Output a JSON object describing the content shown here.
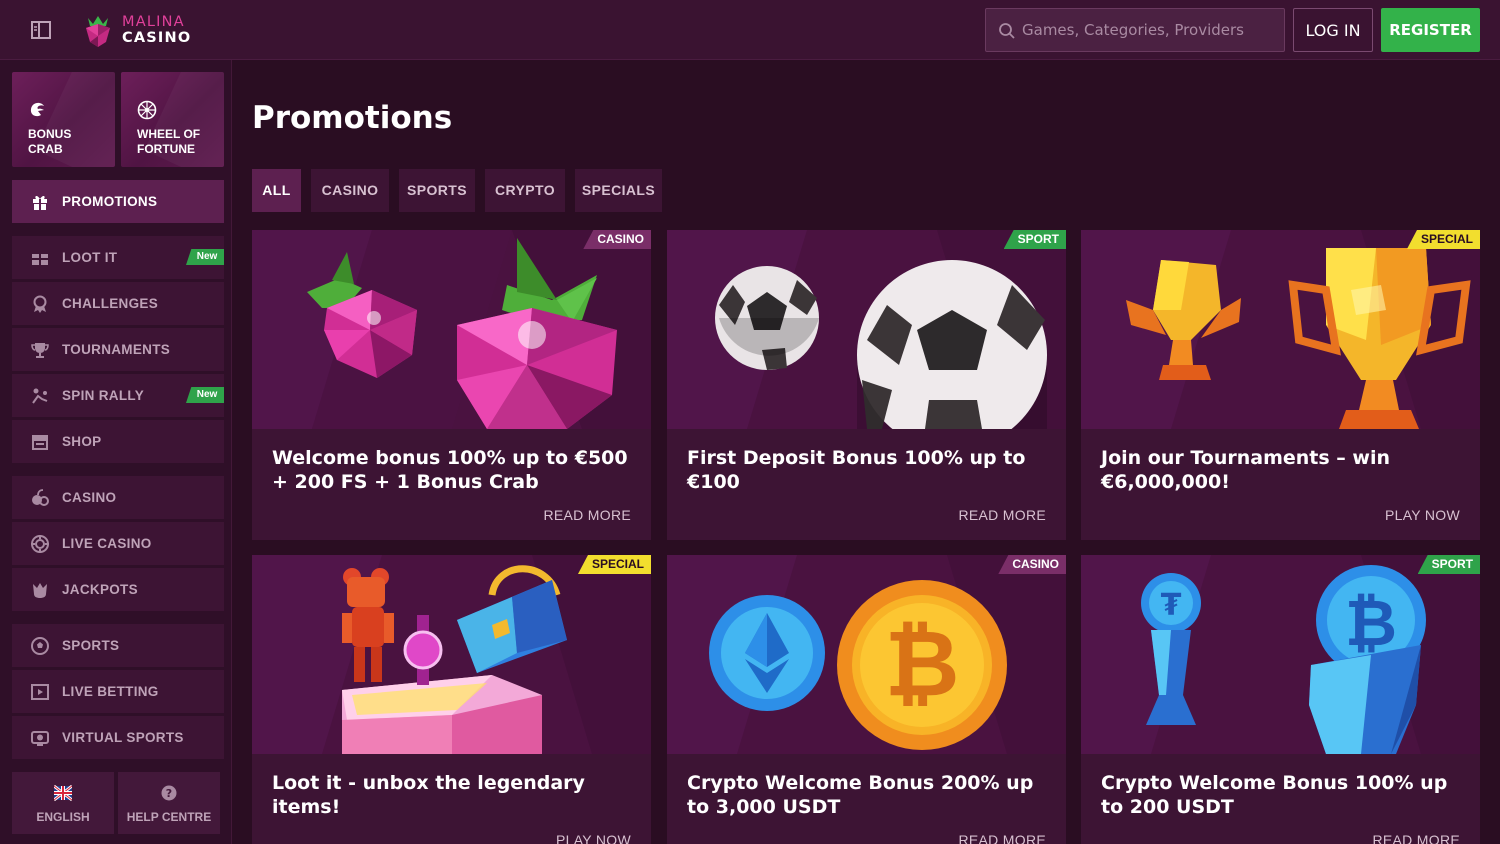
{
  "header": {
    "logo_line1": "MALINA",
    "logo_line2": "CASINO",
    "search_placeholder": "Games, Categories, Providers",
    "login_label": "LOG IN",
    "register_label": "REGISTER"
  },
  "sidebar": {
    "tiles": [
      {
        "label": "BONUS CRAB",
        "icon": "crab-claw-icon"
      },
      {
        "label": "WHEEL OF FORTUNE",
        "icon": "wheel-icon"
      }
    ],
    "promotions_label": "PROMOTIONS",
    "items": [
      {
        "label": "LOOT IT",
        "badge": "New",
        "icon": "gift-icon"
      },
      {
        "label": "CHALLENGES",
        "badge": "",
        "icon": "medal-icon"
      },
      {
        "label": "TOURNAMENTS",
        "badge": "",
        "icon": "trophy-icon"
      },
      {
        "label": "SPIN RALLY",
        "badge": "New",
        "icon": "rally-icon"
      },
      {
        "label": "SHOP",
        "badge": "",
        "icon": "shop-icon"
      },
      {
        "label": "CASINO",
        "badge": "",
        "icon": "casino-icon"
      },
      {
        "label": "LIVE CASINO",
        "badge": "",
        "icon": "chip-icon"
      },
      {
        "label": "JACKPOTS",
        "badge": "",
        "icon": "jackpot-icon"
      },
      {
        "label": "SPORTS",
        "badge": "",
        "icon": "football-icon"
      },
      {
        "label": "LIVE BETTING",
        "badge": "",
        "icon": "live-betting-icon"
      },
      {
        "label": "VIRTUAL SPORTS",
        "badge": "",
        "icon": "virtual-sports-icon"
      }
    ],
    "footer": {
      "language_label": "ENGLISH",
      "help_label": "HELP CENTRE"
    }
  },
  "main": {
    "title": "Promotions",
    "tabs": [
      "ALL",
      "CASINO",
      "SPORTS",
      "CRYPTO",
      "SPECIALS"
    ],
    "cards": [
      {
        "tag": "CASINO",
        "title": "Welcome bonus 100% up to €500 + 200 FS + 1 Bonus Crab",
        "cta": "READ MORE"
      },
      {
        "tag": "SPORT",
        "title": "First Deposit Bonus 100% up to €100",
        "cta": "READ MORE"
      },
      {
        "tag": "SPECIAL",
        "title": "Join our Tournaments – win €6,000,000!",
        "cta": "PLAY NOW"
      },
      {
        "tag": "SPECIAL",
        "title": "Loot it - unbox the legendary items!",
        "cta": "PLAY NOW"
      },
      {
        "tag": "CASINO",
        "title": "Crypto Welcome Bonus 200% up to 3,000 USDT",
        "cta": "READ MORE"
      },
      {
        "tag": "SPORT",
        "title": "Crypto Welcome Bonus 100% up to 200 USDT",
        "cta": "READ MORE"
      }
    ]
  },
  "colors": {
    "background": "#2a0d22",
    "panel": "#3d1434",
    "active": "#5d2050",
    "register": "#33b24a",
    "brand_pink": "#e0409a",
    "tag_special": "#f2de2e",
    "tag_sport": "#2fa34a",
    "tag_casino": "#7a2e68"
  }
}
